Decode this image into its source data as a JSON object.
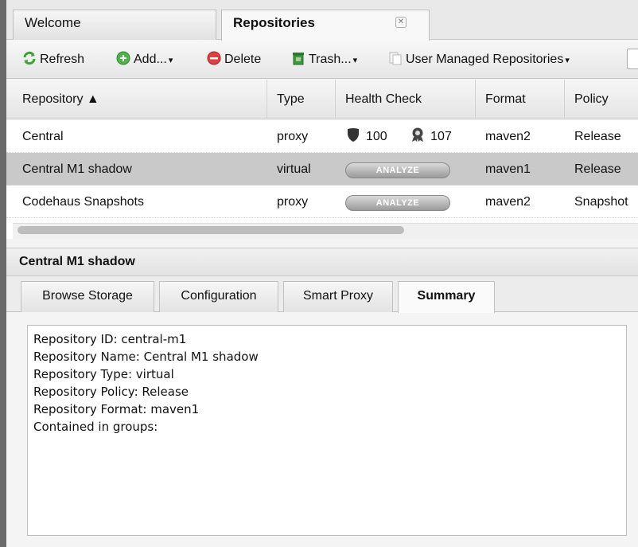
{
  "top_tabs": [
    {
      "label": "Welcome"
    },
    {
      "label": "Repositories",
      "close": "✕"
    }
  ],
  "toolbar": {
    "refresh": "Refresh",
    "add": "Add...",
    "delete": "Delete",
    "trash": "Trash...",
    "managed": "User Managed Repositories",
    "caret": "▾"
  },
  "grid": {
    "columns": [
      "Repository ▲",
      "Type",
      "Health Check",
      "Format",
      "Policy"
    ],
    "rows": [
      {
        "name": "Central",
        "type": "proxy",
        "health_security": "100",
        "health_license": "107",
        "format": "maven2",
        "policy": "Release"
      },
      {
        "name": "Central M1 shadow",
        "type": "virtual",
        "health_button": "ANALYZE",
        "format": "maven1",
        "policy": "Release"
      },
      {
        "name": "Codehaus Snapshots",
        "type": "proxy",
        "health_button": "ANALYZE",
        "format": "maven2",
        "policy": "Snapshot"
      }
    ]
  },
  "detail": {
    "title": "Central M1 shadow",
    "tabs": [
      "Browse Storage",
      "Configuration",
      "Smart Proxy",
      "Summary"
    ],
    "summary_lines": [
      "Repository ID: central-m1",
      "Repository Name: Central M1 shadow",
      "Repository Type: virtual",
      "Repository Policy: Release",
      "Repository Format: maven1",
      "Contained in groups:"
    ]
  },
  "colors": {
    "selected_row": "#c9c9c9",
    "refresh_icon": "#3aa335",
    "add_icon": "#4db34a",
    "delete_icon": "#e04040",
    "trash_icon": "#3c9a3c"
  },
  "icons": [
    "refresh-icon",
    "add-icon",
    "delete-icon",
    "trash-icon",
    "managed-repos-icon",
    "shield-icon",
    "license-badge-icon",
    "close-icon"
  ]
}
